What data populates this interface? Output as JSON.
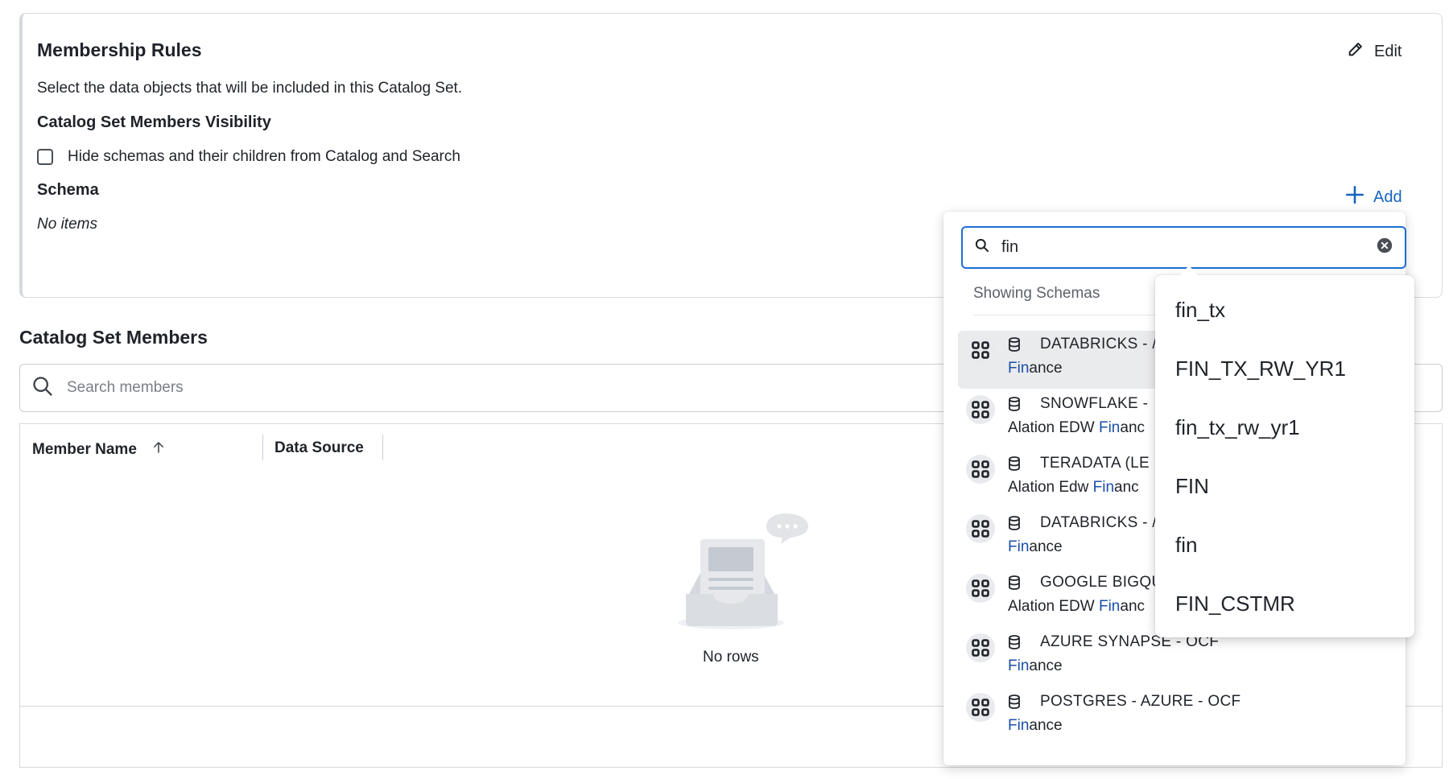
{
  "rules": {
    "title": "Membership Rules",
    "edit_label": "Edit",
    "description": "Select the data objects that will be included in this Catalog Set.",
    "visibility_title": "Catalog Set Members Visibility",
    "hide_checkbox_label": "Hide schemas and their children from Catalog and Search",
    "schema_title": "Schema",
    "add_label": "Add",
    "no_items": "No items"
  },
  "members": {
    "title": "Catalog Set Members",
    "search_placeholder": "Search members",
    "columns": [
      "Member Name",
      "Data Source"
    ],
    "empty_text": "No rows"
  },
  "dropdown": {
    "search_value": "fin",
    "showing_label": "Showing Schemas",
    "results": [
      {
        "title": "DATABRICKS - /",
        "sub_match": "Fin",
        "sub_rest": "ance",
        "sub_prefix": ""
      },
      {
        "title": "SNOWFLAKE -",
        "sub_prefix": "Alation EDW ",
        "sub_match": "Fin",
        "sub_rest": "anc"
      },
      {
        "title": "TERADATA (LE",
        "sub_prefix": "Alation Edw ",
        "sub_match": "Fin",
        "sub_rest": "anc"
      },
      {
        "title": "DATABRICKS - /",
        "sub_prefix": "",
        "sub_match": "Fin",
        "sub_rest": "ance"
      },
      {
        "title": "GOOGLE BIGQU",
        "sub_prefix": "Alation EDW ",
        "sub_match": "Fin",
        "sub_rest": "anc"
      },
      {
        "title": "AZURE SYNAPSE - OCF",
        "sub_prefix": "",
        "sub_match": "Fin",
        "sub_rest": "ance"
      },
      {
        "title": "POSTGRES - AZURE - OCF",
        "sub_prefix": "",
        "sub_match": "Fin",
        "sub_rest": "ance"
      }
    ]
  },
  "suggestions": [
    "fin_tx",
    "FIN_TX_RW_YR1",
    "fin_tx_rw_yr1",
    "FIN",
    "fin",
    "FIN_CSTMR"
  ],
  "colors": {
    "accent": "#1b6ed6",
    "link": "#1565c0",
    "highlight": "#1b4fa8"
  }
}
